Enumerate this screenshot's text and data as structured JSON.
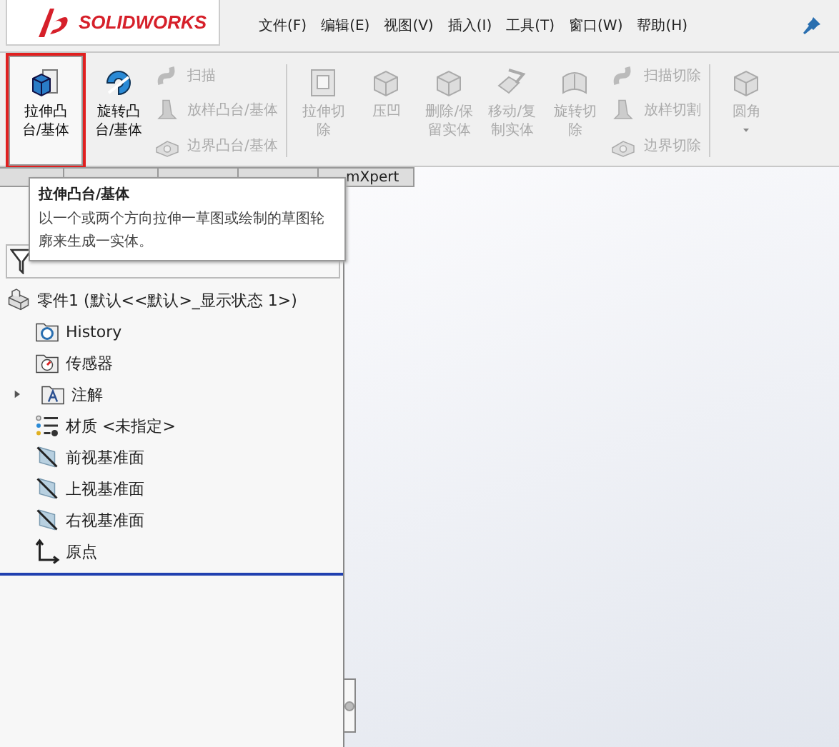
{
  "logo": {
    "text": "SOLIDWORKS"
  },
  "menu": [
    "文件(F)",
    "编辑(E)",
    "视图(V)",
    "插入(I)",
    "工具(T)",
    "窗口(W)",
    "帮助(H)"
  ],
  "toolbar": [
    {
      "kind": "big",
      "label": "拉伸凸台/基体",
      "disabled": false,
      "selected": true
    },
    {
      "kind": "big",
      "label": "旋转凸台/基体",
      "disabled": false,
      "selected": false
    },
    {
      "kind": "stack",
      "items": [
        {
          "label": "扫描",
          "disabled": true
        },
        {
          "label": "放样凸台/基体",
          "disabled": true
        },
        {
          "label": "边界凸台/基体",
          "disabled": true
        }
      ]
    },
    {
      "kind": "separator"
    },
    {
      "kind": "big",
      "label": "拉伸切除",
      "disabled": true,
      "selected": false
    },
    {
      "kind": "big",
      "label": "压凹",
      "disabled": true,
      "selected": false
    },
    {
      "kind": "big",
      "label": "删除/保留实体",
      "disabled": true,
      "selected": false
    },
    {
      "kind": "big",
      "label": "移动/复制实体",
      "disabled": true,
      "selected": false
    },
    {
      "kind": "big",
      "label": "旋转切除",
      "disabled": true,
      "selected": false
    },
    {
      "kind": "stack",
      "items": [
        {
          "label": "扫描切除",
          "disabled": true
        },
        {
          "label": "放样切割",
          "disabled": true
        },
        {
          "label": "边界切除",
          "disabled": true
        }
      ]
    },
    {
      "kind": "separator"
    },
    {
      "kind": "dropdown",
      "label": "圆角",
      "disabled": true,
      "selected": false
    }
  ],
  "tabs": [
    {
      "label": "mXpert"
    }
  ],
  "tooltip": {
    "title": "拉伸凸台/基体",
    "text": "以一个或两个方向拉伸一草图或绘制的草图轮廓来生成一实体。"
  },
  "tree": [
    {
      "kind": "part",
      "label": "零件1  (默认<<默认>_显示状态 1>)"
    },
    {
      "kind": "history",
      "label": "History"
    },
    {
      "kind": "sensor",
      "label": "传感器"
    },
    {
      "kind": "annotation",
      "label": "注解",
      "expanded": false
    },
    {
      "kind": "material",
      "label": "材质 <未指定>"
    },
    {
      "kind": "plane",
      "label": "前视基准面"
    },
    {
      "kind": "plane",
      "label": "上视基准面"
    },
    {
      "kind": "plane",
      "label": "右视基准面"
    },
    {
      "kind": "origin",
      "label": "原点"
    }
  ]
}
